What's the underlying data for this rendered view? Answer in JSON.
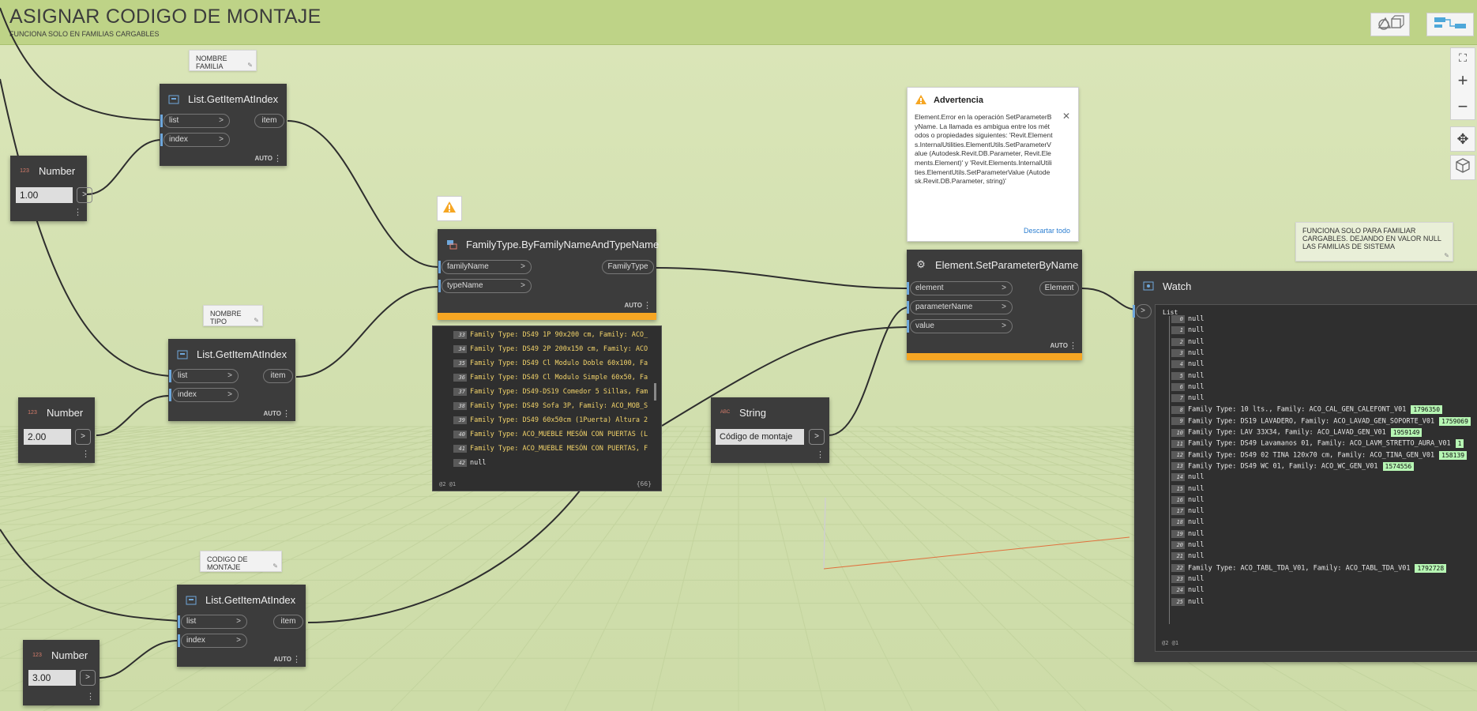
{
  "group": {
    "title": "ASIGNAR CODIGO DE MONTAJE",
    "subtitle": "FUNCIONA SOLO EN FAMILIAS CARGABLES"
  },
  "view_toggles": [
    "geometry-view-icon",
    "graph-view-icon"
  ],
  "nav_controls": [
    "zoom-fit-icon",
    "zoom-in-icon",
    "zoom-out-icon",
    "pan-icon",
    "orbit-icon"
  ],
  "notes": {
    "nombre_familia": "NOMBRE FAMILIA",
    "nombre_tipo": "NOMBRE TIPO",
    "codigo_montaje": "CODIGO DE MONTAJE",
    "funciona": "FUNCIONA SOLO PARA FAMILIAR CARGABLES. DEJANDO EN VALOR NULL LAS FAMILIAS DE SISTEMA"
  },
  "nodes": {
    "getitem1": {
      "title": "List.GetItemAtIndex",
      "in": [
        "list",
        "index"
      ],
      "out": "item",
      "lacing": "AUTO"
    },
    "getitem2": {
      "title": "List.GetItemAtIndex",
      "in": [
        "list",
        "index"
      ],
      "out": "item",
      "lacing": "AUTO"
    },
    "getitem3": {
      "title": "List.GetItemAtIndex",
      "in": [
        "list",
        "index"
      ],
      "out": "item",
      "lacing": "AUTO"
    },
    "number1": {
      "title": "Number",
      "value": "1.00",
      "btn": ">"
    },
    "number2": {
      "title": "Number",
      "value": "2.00",
      "btn": ">"
    },
    "number3": {
      "title": "Number",
      "value": "3.00",
      "btn": ">"
    },
    "familytype": {
      "title": "FamilyType.ByFamilyNameAndTypeName",
      "in": [
        "familyName",
        "typeName"
      ],
      "out": "FamilyType",
      "lacing": "AUTO"
    },
    "setparam": {
      "title": "Element.SetParameterByName",
      "in": [
        "element",
        "parameterName",
        "value"
      ],
      "out": "Element",
      "lacing": "AUTO"
    },
    "string": {
      "title": "String",
      "value": "Código de montaje",
      "btn": ">"
    },
    "watch": {
      "title": "Watch",
      "port": ">",
      "list_label": "List",
      "footer": "@2 @1"
    }
  },
  "family_preview": {
    "rows": [
      {
        "i": "33",
        "t": "Family Type: DS49 1P 90x200 cm, Family: ACO_"
      },
      {
        "i": "34",
        "t": "Family Type: DS49 2P 200x150 cm, Family: ACO"
      },
      {
        "i": "35",
        "t": "Family Type: DS49 Cl Modulo Doble 60x100, Fa"
      },
      {
        "i": "36",
        "t": "Family Type: DS49 Cl Modulo Simple 60x50, Fa"
      },
      {
        "i": "37",
        "t": "Family Type: DS49-DS19 Comedor 5 Sillas, Fam"
      },
      {
        "i": "38",
        "t": "Family Type: DS49 Sofa 3P, Family: ACO_MOB_S"
      },
      {
        "i": "39",
        "t": "Family Type: DS49 60x50cm (1Puerta) Altura 2"
      },
      {
        "i": "40",
        "t": "Family Type: ACO_MUEBLE MESÓN CON PUERTAS (L"
      },
      {
        "i": "41",
        "t": "Family Type: ACO_MUEBLE MESÓN CON PUERTAS, F"
      },
      {
        "i": "42",
        "t": "null"
      }
    ],
    "footer_left": "@2 @1",
    "footer_right": "{66}"
  },
  "warning": {
    "title": "Advertencia",
    "body": "Element.Error en la operación SetParameterByName. La llamada es ambigua entre los métodos o propiedades siguientes: 'Revit.Elements.InternalUtilities.ElementUtils.SetParameterValue (Autodesk.Revit.DB.Parameter, Revit.Elements.Element)' y 'Revit.Elements.InternalUtilities.ElementUtils.SetParameterValue (Autodesk.Revit.DB.Parameter, string)'",
    "dismiss": "Descartar todo"
  },
  "watch_rows": [
    {
      "i": "0",
      "t": "null"
    },
    {
      "i": "1",
      "t": "null"
    },
    {
      "i": "2",
      "t": "null"
    },
    {
      "i": "3",
      "t": "null"
    },
    {
      "i": "4",
      "t": "null"
    },
    {
      "i": "5",
      "t": "null"
    },
    {
      "i": "6",
      "t": "null"
    },
    {
      "i": "7",
      "t": "null"
    },
    {
      "i": "8",
      "t": "Family Type: 10 lts., Family: ACO_CAL_GEN_CALEFONT_V01",
      "b": "1796350"
    },
    {
      "i": "9",
      "t": "Family Type: DS19 LAVADERO, Family: ACO_LAVAD_GEN_SOPORTE_V01",
      "b": "1759069"
    },
    {
      "i": "10",
      "t": "Family Type: LAV 33X34, Family: ACO_LAVAD_GEN_V01",
      "b": "1959149"
    },
    {
      "i": "11",
      "t": "Family Type: DS49 Lavamanos 01, Family: ACO_LAVM_STRETTO_AURA_V01",
      "b": "1"
    },
    {
      "i": "12",
      "t": "Family Type: DS49 02 TINA 120x70 cm, Family: ACO_TINA_GEN_V01",
      "b": "158139"
    },
    {
      "i": "13",
      "t": "Family Type: DS49 WC 01, Family: ACO_WC_GEN_V01",
      "b": "1574556"
    },
    {
      "i": "14",
      "t": "null"
    },
    {
      "i": "15",
      "t": "null"
    },
    {
      "i": "16",
      "t": "null"
    },
    {
      "i": "17",
      "t": "null"
    },
    {
      "i": "18",
      "t": "null"
    },
    {
      "i": "19",
      "t": "null"
    },
    {
      "i": "20",
      "t": "null"
    },
    {
      "i": "21",
      "t": "null"
    },
    {
      "i": "22",
      "t": "Family Type: ACO_TABL_TDA_V01, Family: ACO_TABL_TDA_V01",
      "b": "1792728"
    },
    {
      "i": "23",
      "t": "null"
    },
    {
      "i": "24",
      "t": "null"
    },
    {
      "i": "25",
      "t": "null"
    }
  ],
  "colors": {
    "canvas": "#d3e0b1",
    "group": "#bed387",
    "node": "#3c3c3c",
    "warning": "#f6a623",
    "port_blue": "#6fa8dc",
    "badge": "#b7f7b4"
  }
}
